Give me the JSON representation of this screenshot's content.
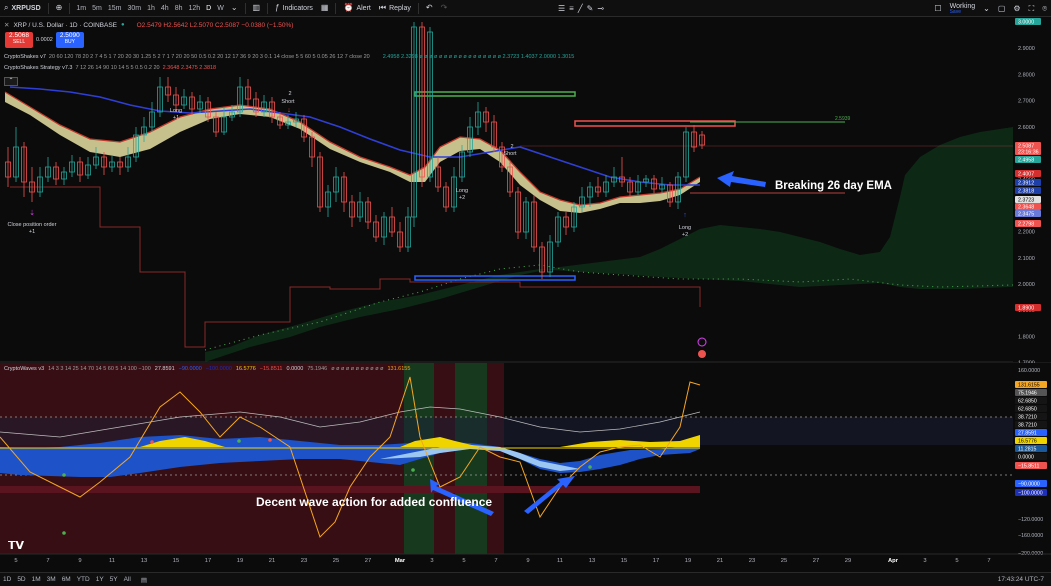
{
  "toolbar": {
    "symbol": "XRPUSD",
    "timeframes": [
      "1m",
      "5m",
      "15m",
      "30m",
      "1h",
      "4h",
      "8h",
      "12h",
      "D",
      "W"
    ],
    "active_timeframe": "D",
    "indicators_label": "Indicators",
    "alert_label": "Alert",
    "replay_label": "Replay",
    "workspace_label": "Working",
    "workspace_sub": "Save"
  },
  "chart": {
    "title": "XRP / U.S. Dollar · 1D · COINBASE",
    "ohlc": "O2.5479 H2.5642 L2.5070 C2.5087 −0.0380 (−1.50%)",
    "sell_price": "2.5068",
    "sell_label": "SELL",
    "spread": "0.0002",
    "buy_price": "2.5090",
    "buy_label": "BUY",
    "indicator1_name": "CryptoShakes v7",
    "indicator1_params": "20 60 120 78 20 2 7 4 5 1 7 20 20 30 1.25 5 2 7 1 7 20 20 50 0.5 0.2 20 12 17 36 9 20 3 0.1 14 close 5 5 60 5 0.05 26 12 7 close 20",
    "indicator1_values": "2.4958  2.3298  ø ø ø ø ø ø ø ø ø ø ø ø ø ø ø ø ø  2.3723  1.4037  2.0000  1.3015",
    "indicator2_name": "CryptoShakes Strategy v7.3",
    "indicator2_params": "7 12 26 14 90 10 14 5 5 0.5 0.2 20",
    "indicator2_values": "2.3648  2.3475  2.3818",
    "osc_name": "CryptoWaves v3",
    "osc_params": "14 3 3 14 25 14 70 14 5 60 5 14 100 −100",
    "osc_values": [
      "27.8591",
      "−90.0000",
      "−100.0000",
      "16.5776",
      "−15.8511",
      "0.0000",
      "75.1946",
      "ø ø ø ø ø ø ø ø ø ø ø",
      "131.6155"
    ]
  },
  "price_scale": {
    "ticks": [
      "3.0000",
      "2.9000",
      "2.8000",
      "2.7000",
      "2.6000",
      "2.5000",
      "2.4000",
      "2.3000",
      "2.2000",
      "2.1000",
      "2.0000",
      "1.9000",
      "1.8000",
      "1.7000"
    ],
    "badges": [
      {
        "text": "3.0000",
        "color": "#26a69a"
      },
      {
        "text": "2.5087",
        "color": "#ef5350"
      },
      {
        "text": "23:16:36",
        "color": "#ef5350"
      },
      {
        "text": "2.4958",
        "color": "#26a69a"
      },
      {
        "text": "2.4007",
        "color": "#d32f2f"
      },
      {
        "text": "2.3912",
        "color": "#1e3fa8"
      },
      {
        "text": "2.3818",
        "color": "#1e3fa8"
      },
      {
        "text": "2.3723",
        "color": "#e0e0e0"
      },
      {
        "text": "2.3648",
        "color": "#ef5350"
      },
      {
        "text": "2.3475",
        "color": "#6a7ad8"
      },
      {
        "text": "2.2798",
        "color": "#ef5350"
      },
      {
        "text": "1.8900",
        "color": "#d32f2f"
      }
    ],
    "green_line_label": "2.5939"
  },
  "osc_scale": {
    "ticks": [
      "160.0000",
      "−80.0000",
      "−120.0000",
      "−160.0000",
      "−200.0000"
    ],
    "badges": [
      {
        "text": "131.6155",
        "color": "#f5a623"
      },
      {
        "text": "75.1946",
        "color": "#555555"
      },
      {
        "text": "62.6850",
        "color": "#151515"
      },
      {
        "text": "62.6850",
        "color": "#151515"
      },
      {
        "text": "38.7210",
        "color": "#151515"
      },
      {
        "text": "38.7210",
        "color": "#151515"
      },
      {
        "text": "27.8591",
        "color": "#2962ff"
      },
      {
        "text": "16.5776",
        "color": "#f0d400"
      },
      {
        "text": "11.2815",
        "color": "#1a5a9a"
      },
      {
        "text": "0.0000",
        "color": "#151515"
      },
      {
        "text": "−15.8511",
        "color": "#ef5350"
      },
      {
        "text": "−90.0000",
        "color": "#2962ff"
      },
      {
        "text": "−100.0000",
        "color": "#1e2fb8"
      }
    ]
  },
  "signals": {
    "short1": "Short",
    "short2": "Short",
    "long1": "Long",
    "long1_n": "+1",
    "long2": "Long",
    "long2_n": "+2",
    "long3": "Long",
    "long3_n": "+2",
    "num_2": "2",
    "close_position": "Close position order",
    "close_n": "+1"
  },
  "annotations": {
    "ema_note": "Breaking 26 day EMA",
    "wave_note": "Decent wave action for added confluence"
  },
  "x_axis": {
    "labels": [
      "5",
      "7",
      "9",
      "11",
      "13",
      "15",
      "17",
      "19",
      "21",
      "23",
      "25",
      "27",
      "Mar",
      "3",
      "5",
      "7",
      "9",
      "11",
      "13",
      "15",
      "17",
      "19",
      "21",
      "23",
      "25",
      "27",
      "29",
      "Apr",
      "3",
      "5",
      "7"
    ]
  },
  "bottom": {
    "ranges": [
      "1D",
      "5D",
      "1M",
      "3M",
      "6M",
      "YTD",
      "1Y",
      "5Y",
      "All"
    ],
    "clock": "17:43:24 UTC-7"
  },
  "colors": {
    "up": "#26a69a",
    "down": "#ef5350",
    "ema": "#2f3fd6",
    "ribbon": "#e8e1a4",
    "cloud": "#0f2a17"
  }
}
